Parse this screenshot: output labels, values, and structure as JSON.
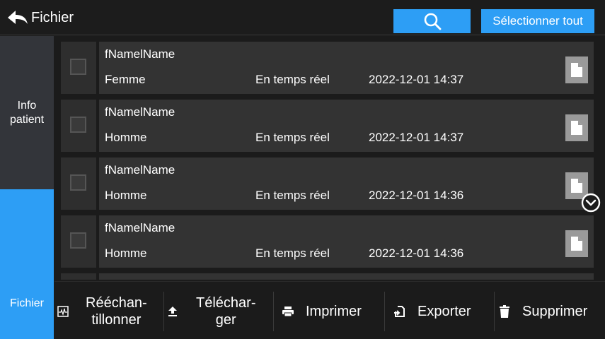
{
  "header": {
    "back_label": "Fichier",
    "select_all_label": "Sélectionner tout"
  },
  "sidebar": {
    "tab_info_label": "Info\npatient",
    "tab_file_label": "Fichier"
  },
  "records": [
    {
      "name": "fNamelName",
      "gender": "Femme",
      "mode": "En temps réel",
      "datetime": "2022-12-01 14:37"
    },
    {
      "name": "fNamelName",
      "gender": "Homme",
      "mode": "En temps réel",
      "datetime": "2022-12-01 14:37"
    },
    {
      "name": "fNamelName",
      "gender": "Homme",
      "mode": "En temps réel",
      "datetime": "2022-12-01 14:36"
    },
    {
      "name": "fNamelName",
      "gender": "Homme",
      "mode": "En temps réel",
      "datetime": "2022-12-01 14:36"
    }
  ],
  "toolbar": {
    "resample_label": "Rééchan-\ntillonner",
    "upload_label": "Téléchar-\nger",
    "print_label": "Imprimer",
    "export_label": "Exporter",
    "delete_label": "Supprimer"
  },
  "colors": {
    "accent": "#2d9ef5",
    "background": "#1b1b1b",
    "card": "#333333"
  }
}
